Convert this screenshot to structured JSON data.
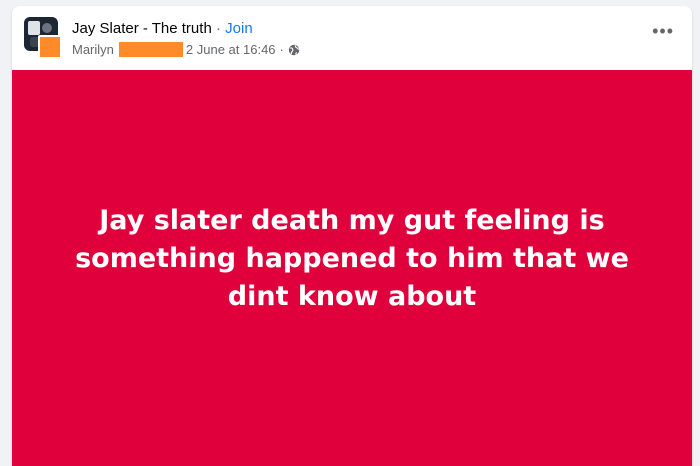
{
  "post": {
    "group_name": "Jay Slater - The truth",
    "separator": "·",
    "join_label": "Join",
    "author_first_name": "Marilyn",
    "timestamp": "2 June at 16:46",
    "meta_separator": "·",
    "privacy_icon": "globe-icon",
    "more_icon": "more-options-icon",
    "more_glyph": "•••",
    "body_text": "Jay slater death my gut feeling is something happened to him that we dint know about",
    "background_color": "#e0003b",
    "redaction_color": "#ff8a2a"
  }
}
